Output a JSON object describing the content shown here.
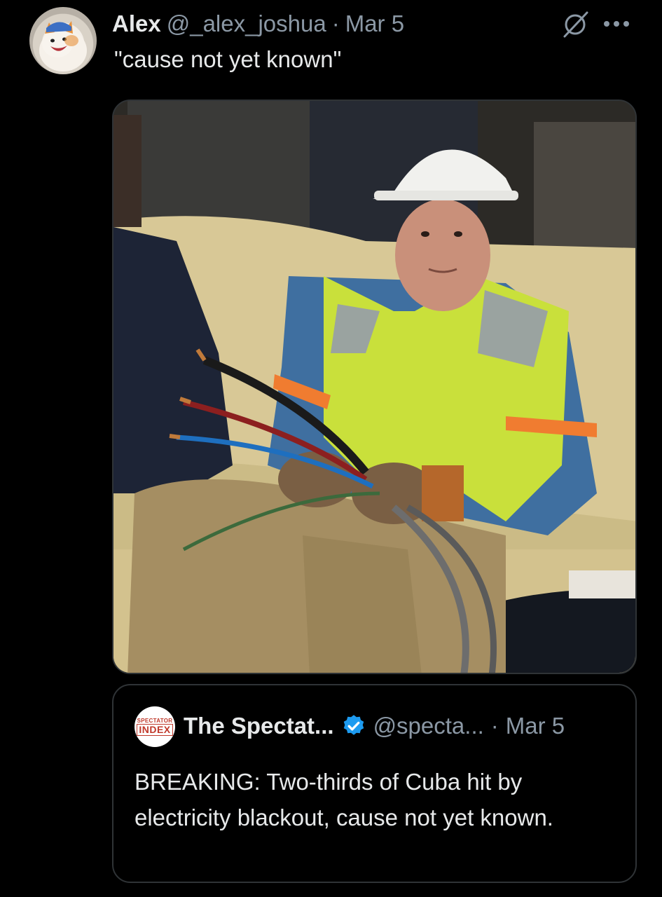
{
  "tweet": {
    "author_name": "Alex",
    "handle": "@_alex_joshua",
    "separator": "·",
    "date": "Mar 5",
    "text": "\"cause not yet known\"",
    "avatar_icon": "cat-avatar-icon",
    "grok_icon": "grok-icon",
    "more_icon": "more-dots-icon"
  },
  "media": {
    "description_icon": "photo-image"
  },
  "quote": {
    "avatar_line1": "SPECTATOR",
    "avatar_line2": "INDEX",
    "author_name": "The Spectat...",
    "verified_icon": "verified-badge-icon",
    "handle": "@specta...",
    "separator": "·",
    "date": "Mar 5",
    "text": "BREAKING: Two-thirds of Cuba hit by electricity blackout, cause not yet known."
  },
  "colors": {
    "background": "#000000",
    "text_primary": "#e7e9ea",
    "text_secondary": "#8b98a5",
    "border": "#2f3336",
    "verified": "#1d9bf0"
  }
}
